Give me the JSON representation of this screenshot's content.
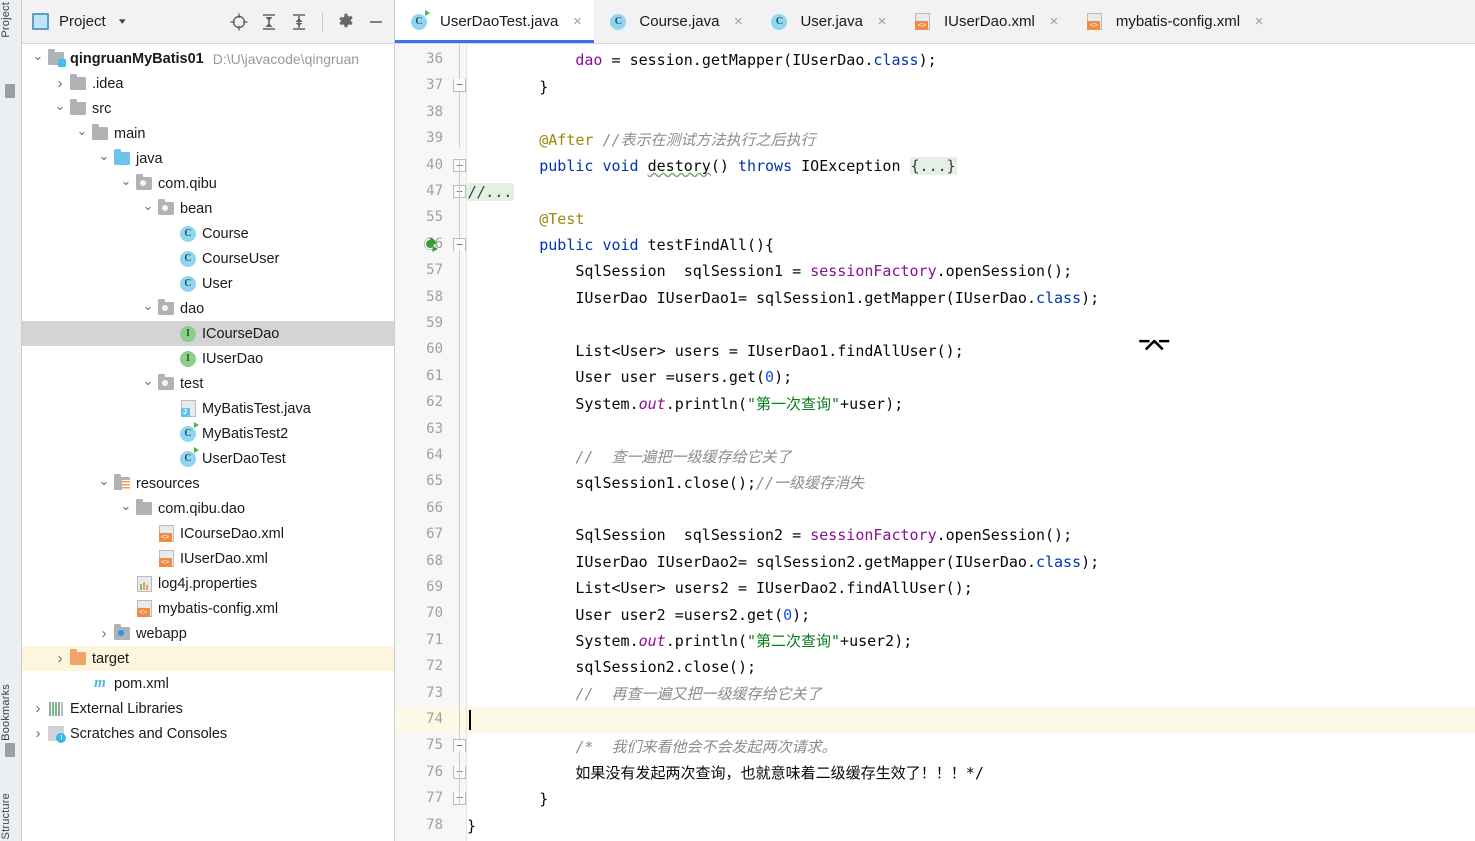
{
  "stripe": {
    "labels": [
      "Project",
      "Bookmarks",
      "Structure"
    ]
  },
  "project_panel": {
    "title": "Project",
    "caret": "▾",
    "toolbar": [
      {
        "name": "locate-icon",
        "label": "Select Opened File"
      },
      {
        "name": "expand-all-icon",
        "label": "Expand All"
      },
      {
        "name": "collapse-all-icon",
        "label": "Collapse All"
      },
      {
        "name": "gear-icon",
        "label": "Options"
      },
      {
        "name": "minimize-icon",
        "label": "Hide"
      }
    ],
    "tree": [
      {
        "indent": 0,
        "arrow": "open",
        "icon": "module-folder",
        "label": "qingruanMyBatis01",
        "bold": true,
        "path": "D:\\U\\javacode\\qingruan",
        "state": "normal"
      },
      {
        "indent": 1,
        "arrow": "closed",
        "icon": "folder",
        "label": ".idea",
        "state": "normal"
      },
      {
        "indent": 1,
        "arrow": "open",
        "icon": "folder",
        "label": "src",
        "state": "normal"
      },
      {
        "indent": 2,
        "arrow": "open",
        "icon": "folder",
        "label": "main",
        "state": "normal"
      },
      {
        "indent": 3,
        "arrow": "open",
        "icon": "source-folder",
        "label": "java",
        "state": "normal"
      },
      {
        "indent": 4,
        "arrow": "open",
        "icon": "package",
        "label": "com.qibu",
        "state": "normal"
      },
      {
        "indent": 5,
        "arrow": "open",
        "icon": "package",
        "label": "bean",
        "state": "normal"
      },
      {
        "indent": 6,
        "arrow": "none",
        "icon": "class",
        "label": "Course",
        "state": "normal"
      },
      {
        "indent": 6,
        "arrow": "none",
        "icon": "class",
        "label": "CourseUser",
        "state": "normal"
      },
      {
        "indent": 6,
        "arrow": "none",
        "icon": "class",
        "label": "User",
        "state": "normal"
      },
      {
        "indent": 5,
        "arrow": "open",
        "icon": "package",
        "label": "dao",
        "state": "normal"
      },
      {
        "indent": 6,
        "arrow": "none",
        "icon": "interface",
        "label": "ICourseDao",
        "state": "selected"
      },
      {
        "indent": 6,
        "arrow": "none",
        "icon": "interface",
        "label": "IUserDao",
        "state": "normal"
      },
      {
        "indent": 5,
        "arrow": "open",
        "icon": "package",
        "label": "test",
        "state": "normal"
      },
      {
        "indent": 6,
        "arrow": "none",
        "icon": "java-file",
        "label": "MyBatisTest.java",
        "state": "normal"
      },
      {
        "indent": 6,
        "arrow": "none",
        "icon": "runnable-class",
        "label": "MyBatisTest2",
        "state": "normal"
      },
      {
        "indent": 6,
        "arrow": "none",
        "icon": "runnable-class",
        "label": "UserDaoTest",
        "state": "normal"
      },
      {
        "indent": 3,
        "arrow": "open",
        "icon": "resource-folder",
        "label": "resources",
        "state": "normal"
      },
      {
        "indent": 4,
        "arrow": "open",
        "icon": "folder",
        "label": "com.qibu.dao",
        "state": "normal"
      },
      {
        "indent": 5,
        "arrow": "none",
        "icon": "xml-file",
        "label": "ICourseDao.xml",
        "state": "normal"
      },
      {
        "indent": 5,
        "arrow": "none",
        "icon": "xml-file",
        "label": "IUserDao.xml",
        "state": "normal"
      },
      {
        "indent": 4,
        "arrow": "none",
        "icon": "properties-file",
        "label": "log4j.properties",
        "state": "normal"
      },
      {
        "indent": 4,
        "arrow": "none",
        "icon": "xml-file",
        "label": "mybatis-config.xml",
        "state": "normal"
      },
      {
        "indent": 3,
        "arrow": "closed",
        "icon": "webapp-folder",
        "label": "webapp",
        "state": "normal"
      },
      {
        "indent": 1,
        "arrow": "closed",
        "icon": "excluded-folder",
        "label": "target",
        "state": "highlighted"
      },
      {
        "indent": 2,
        "arrow": "none",
        "icon": "maven-file",
        "label": "pom.xml",
        "state": "normal"
      },
      {
        "indent": 0,
        "arrow": "closed",
        "icon": "library",
        "label": "External Libraries",
        "state": "normal"
      },
      {
        "indent": 0,
        "arrow": "closed",
        "icon": "scratch",
        "label": "Scratches and Consoles",
        "state": "normal"
      }
    ]
  },
  "editor": {
    "tabs": [
      {
        "label": "UserDaoTest.java",
        "icon": "runnable-class-icon",
        "active": true,
        "close": "×"
      },
      {
        "label": "Course.java",
        "icon": "class-icon",
        "active": false,
        "close": "×"
      },
      {
        "label": "User.java",
        "icon": "class-icon",
        "active": false,
        "close": "×"
      },
      {
        "label": "IUserDao.xml",
        "icon": "xml-icon",
        "active": false,
        "close": "×"
      },
      {
        "label": "mybatis-config.xml",
        "icon": "xml-icon",
        "active": false,
        "close": "×"
      }
    ],
    "line_numbers": [
      "36",
      "37",
      "38",
      "39",
      "40",
      "47",
      "55",
      "56",
      "57",
      "58",
      "59",
      "60",
      "61",
      "62",
      "63",
      "64",
      "65",
      "66",
      "67",
      "68",
      "69",
      "70",
      "71",
      "72",
      "73",
      "74",
      "75",
      "76",
      "77",
      "78"
    ],
    "code_lines": [
      "            dao = session.getMapper(IUserDao.class);",
      "        }",
      "",
      "        @After //表示在测试方法执行之后执行",
      "        public void destory() throws IOException {...}",
      "//...",
      "        @Test",
      "        public void testFindAll(){",
      "            SqlSession  sqlSession1 = sessionFactory.openSession();",
      "            IUserDao IUserDao1= sqlSession1.getMapper(IUserDao.class);",
      "",
      "            List<User> users = IUserDao1.findAllUser();",
      "            User user =users.get(0);",
      "            System.out.println(\"第一次查询\"+user);",
      "",
      "            //  查一遍把一级缓存给它关了",
      "            sqlSession1.close();//一级缓存消失",
      "",
      "            SqlSession  sqlSession2 = sessionFactory.openSession();",
      "            IUserDao IUserDao2= sqlSession2.getMapper(IUserDao.class);",
      "            List<User> users2 = IUserDao2.findAllUser();",
      "            User user2 =users2.get(0);",
      "            System.out.println(\"第二次查询\"+user2);",
      "            sqlSession2.close();",
      "            //  再查一遍又把一级缓存给它关了",
      "",
      "            /*  我们来看他会不会发起两次请求。",
      "            如果没有发起两次查询，也就意味着二级缓存生效了！！！*/",
      "        }",
      "}"
    ],
    "caret_line": "74",
    "highlighted_line": "74",
    "gutter_run_marker_line": "56"
  },
  "colors": {
    "accent": "#3574f0",
    "keyword": "#0033b3",
    "string": "#067d17",
    "number": "#1750eb",
    "comment": "#8c8c8c",
    "annotation": "#9e880d",
    "field": "#871094",
    "selection": "#d4d4d4",
    "highlight_row": "#fdf6dd"
  }
}
